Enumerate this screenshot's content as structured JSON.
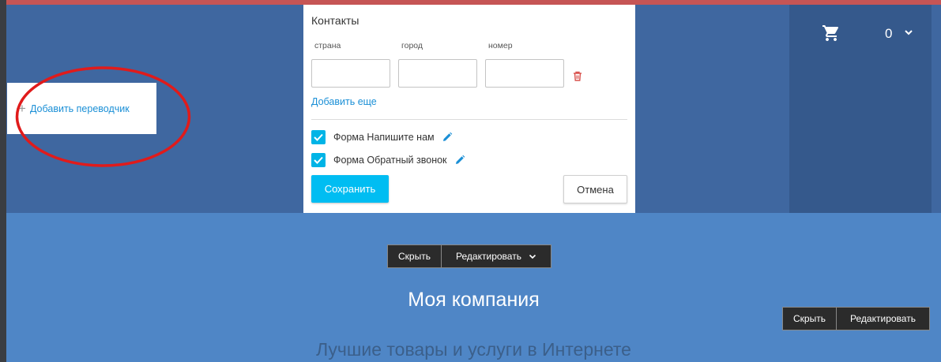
{
  "colors": {
    "header_bg": "#3f67a0",
    "page_bg": "#4f86c6",
    "top_stripe": "#c65555",
    "cart_panel_bg": "#35598c",
    "accent": "#00bdf2",
    "link": "#1a8fd6",
    "delete": "#d9534f",
    "annotation_circle": "#e01b1b"
  },
  "header": {
    "cart": {
      "icon": "cart-icon",
      "count": "0",
      "chevron_icon": "chevron-down-icon"
    }
  },
  "add_translator": {
    "plus_icon": "plus-icon",
    "label": "Добавить переводчик"
  },
  "contacts": {
    "title": "Контакты",
    "fields": {
      "country": {
        "label": "страна",
        "value": ""
      },
      "city": {
        "label": "город",
        "value": ""
      },
      "number": {
        "label": "номер",
        "value": ""
      }
    },
    "delete_icon": "trash-icon",
    "add_more": "Добавить еще",
    "forms": [
      {
        "label": "Форма Напишите нам",
        "checked": true,
        "edit_icon": "pencil-icon"
      },
      {
        "label": "Форма Обратный звонок",
        "checked": true,
        "edit_icon": "pencil-icon"
      }
    ],
    "save_label": "Сохранить",
    "cancel_label": "Отмена"
  },
  "section_controls": {
    "hide_label": "Скрыть",
    "edit_label": "Редактировать",
    "edit_chevron_icon": "chevron-down-icon"
  },
  "side_controls": {
    "hide_label": "Скрыть",
    "edit_label": "Редактировать"
  },
  "hero": {
    "title": "Моя компания",
    "subtitle": "Лучшие товары и услуги в Интернете"
  }
}
